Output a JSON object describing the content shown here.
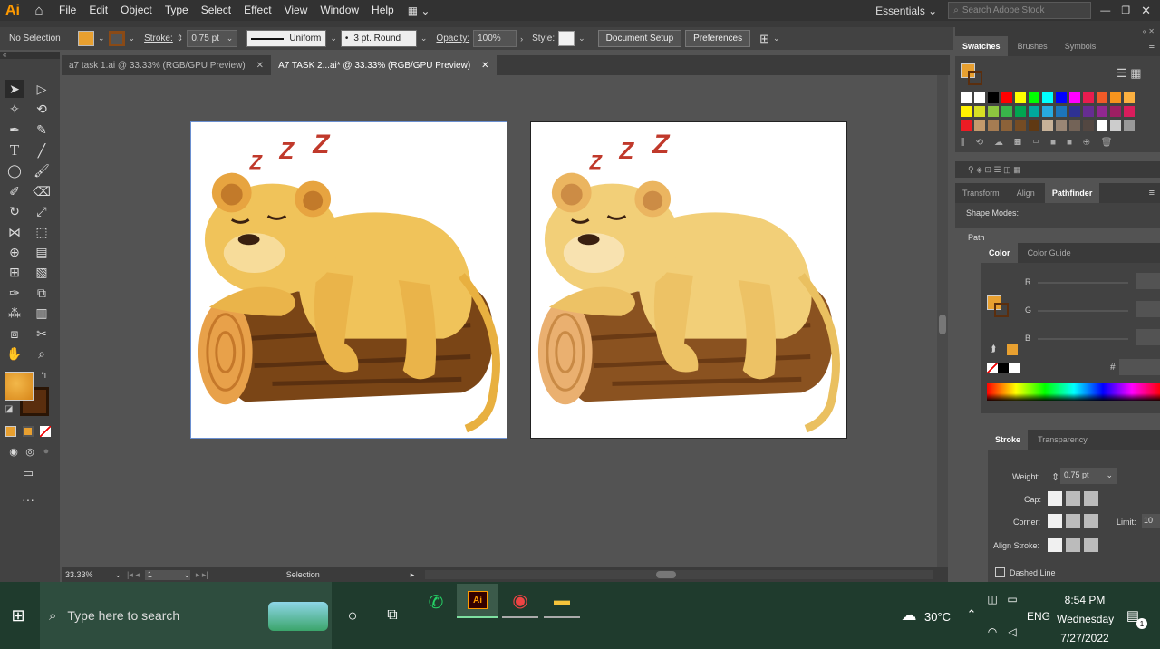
{
  "app": {
    "logo": "Ai",
    "menus": [
      "File",
      "Edit",
      "Object",
      "Type",
      "Select",
      "Effect",
      "View",
      "Window",
      "Help"
    ],
    "workspace": "Essentials",
    "search_placeholder": "Search Adobe Stock"
  },
  "control": {
    "selection": "No Selection",
    "stroke_label": "Stroke:",
    "stroke_value": "0.75 pt",
    "profile": "Uniform",
    "brush": "3 pt. Round",
    "opacity_label": "Opacity:",
    "opacity_value": "100%",
    "style_label": "Style:",
    "doc_setup": "Document Setup",
    "preferences": "Preferences"
  },
  "tabs": [
    {
      "label": "a7 task 1.ai @ 33.33% (RGB/GPU Preview)"
    },
    {
      "label": "A7 TASK 2...ai* @ 33.33% (RGB/GPU Preview)"
    }
  ],
  "artboards": [
    {
      "zzz": "Z Z Z"
    },
    {
      "zzz": "Z Z Z"
    }
  ],
  "status": {
    "zoom": "33.33%",
    "page": "1",
    "tool": "Selection"
  },
  "panels": {
    "swatches_tabs": [
      "Swatches",
      "Brushes",
      "Symbols"
    ],
    "path_tabs": [
      "Transform",
      "Align",
      "Pathfinder"
    ],
    "shape_modes": "Shape Modes:",
    "path_short": "Path",
    "color_tabs": [
      "Color",
      "Color Guide"
    ],
    "rgb": [
      "R",
      "G",
      "B"
    ],
    "hash": "#",
    "stroke_tabs": [
      "Stroke",
      "Transparency"
    ],
    "weight_label": "Weight:",
    "weight_value": "0.75 pt",
    "cap_label": "Cap:",
    "corner_label": "Corner:",
    "limit_label": "Limit:",
    "limit_value": "10",
    "align_label": "Align Stroke:",
    "dashed": "Dashed Line"
  },
  "colors": {
    "fill": "#e8a030",
    "stroke": "#6b3a12",
    "accent": "#ff9a00"
  },
  "taskbar": {
    "search_placeholder": "Type here to search",
    "weather": "30°C",
    "lang": "ENG",
    "time": "8:54 PM",
    "day": "Wednesday",
    "date": "7/27/2022",
    "notifications": "1"
  }
}
